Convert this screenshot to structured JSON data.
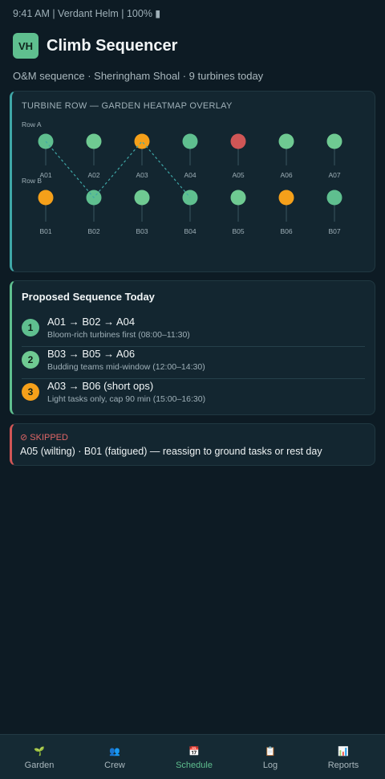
{
  "status_bar": {
    "text": "9:41 AM | Verdant Helm | 100% ▮"
  },
  "header": {
    "logo_text": "VH",
    "title": "Climb Sequencer",
    "subtitle": "O&M sequence · Sheringham Shoal · 9 turbines today"
  },
  "heatmap": {
    "title": "TURBINE ROW — GARDEN HEATMAP OVERLAY",
    "colors": {
      "bloom": "#5fbf8f",
      "budding": "#6fca92",
      "wilting": "#d05656",
      "fatigued": "#f5a01a"
    },
    "rows": [
      {
        "label": "Row A",
        "turbines": [
          {
            "id": "A01",
            "status": "bloom"
          },
          {
            "id": "A02",
            "status": "budding"
          },
          {
            "id": "A03",
            "status": "fatigued"
          },
          {
            "id": "A04",
            "status": "bloom"
          },
          {
            "id": "A05",
            "status": "wilting"
          },
          {
            "id": "A06",
            "status": "budding"
          },
          {
            "id": "A07",
            "status": "budding"
          }
        ]
      },
      {
        "label": "Row B",
        "turbines": [
          {
            "id": "B01",
            "status": "fatigued"
          },
          {
            "id": "B02",
            "status": "bloom"
          },
          {
            "id": "B03",
            "status": "budding"
          },
          {
            "id": "B04",
            "status": "bloom"
          },
          {
            "id": "B05",
            "status": "budding"
          },
          {
            "id": "B06",
            "status": "fatigued"
          },
          {
            "id": "B07",
            "status": "bloom"
          }
        ]
      }
    ],
    "route": [
      "A01",
      "B02",
      "A03",
      "B04"
    ]
  },
  "sequence": {
    "title": "Proposed Sequence Today",
    "items": [
      {
        "num": "1",
        "route": "A01 → B02 → A04",
        "note": "Bloom-rich turbines first (08:00–11:30)",
        "color": "#5fbf8f"
      },
      {
        "num": "2",
        "route": "B03 → B05 → A06",
        "note": "Budding teams mid-window (12:00–14:30)",
        "color": "#6fca92"
      },
      {
        "num": "3",
        "route": "A03 → B06 (short ops)",
        "note": "Light tasks only, cap 90 min (15:00–16:30)",
        "color": "#f5a01a"
      }
    ]
  },
  "skipped": {
    "label": "⊘ SKIPPED",
    "text": "A05 (wilting) · B01 (fatigued) — reassign to ground tasks or rest day"
  },
  "nav": {
    "items": [
      {
        "icon": "🌱",
        "icon_name": "sprout-icon",
        "label": "Garden",
        "active": false
      },
      {
        "icon": "👥",
        "icon_name": "people-icon",
        "label": "Crew",
        "active": false
      },
      {
        "icon": "📅",
        "icon_name": "calendar-icon",
        "label": "Schedule",
        "active": true
      },
      {
        "icon": "📋",
        "icon_name": "clipboard-icon",
        "label": "Log",
        "active": false
      },
      {
        "icon": "📊",
        "icon_name": "bar-chart-icon",
        "label": "Reports",
        "active": false
      }
    ]
  }
}
